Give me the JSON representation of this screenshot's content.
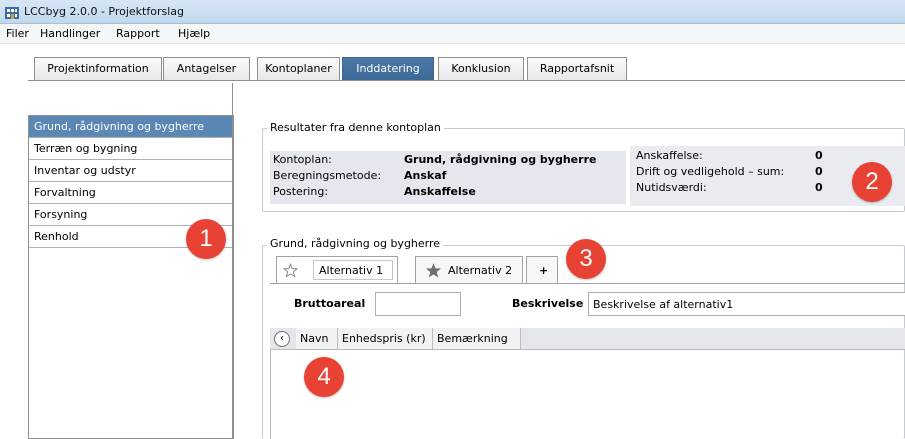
{
  "window": {
    "title": "LCCbyg 2.0.0 - Projektforslag",
    "icon": "app-building-icon"
  },
  "menu": [
    "Filer",
    "Handlinger",
    "Rapport",
    "Hjælp"
  ],
  "tabs": [
    "Projektinformation",
    "Antagelser",
    "Kontoplaner",
    "Inddatering",
    "Konklusion",
    "Rapportafsnit"
  ],
  "active_tab": "Inddatering",
  "sidebar": {
    "items": [
      "Grund, rådgivning og bygherre",
      "Terræn og bygning",
      "Inventar og udstyr",
      "Forvaltning",
      "Forsyning",
      "Renhold"
    ],
    "active": "Grund, rådgivning og bygherre"
  },
  "results": {
    "title": "Resultater fra denne kontoplan",
    "rows": [
      {
        "label": "Kontoplan:",
        "value": "Grund, rådgivning og bygherre"
      },
      {
        "label": "Beregningsmetode:",
        "value": "Anskaf"
      },
      {
        "label": "Postering:",
        "value": "Anskaffelse"
      }
    ],
    "summary": [
      {
        "label": "Anskaffelse:",
        "value": "0"
      },
      {
        "label": "Drift og vedligehold – sum:",
        "value": "0"
      },
      {
        "label": "Nutidsværdi:",
        "value": "0"
      }
    ]
  },
  "section": {
    "title": "Grund, rådgivning og bygherre",
    "alternatives": [
      {
        "label": "Alternativ 1",
        "starred": false
      },
      {
        "label": "Alternativ 2",
        "starred": true
      }
    ],
    "add_label": "+",
    "fields": {
      "bruttoareal_label": "Bruttoareal",
      "bruttoareal_value": "",
      "beskrivelse_label": "Beskrivelse",
      "beskrivelse_value": "Beskrivelse af alternativ1"
    },
    "grid": {
      "columns": [
        "Navn",
        "Enhedspris (kr)",
        "Bemærkning"
      ]
    }
  },
  "callouts": [
    "1",
    "2",
    "3",
    "4"
  ],
  "colors": {
    "accent": "#4a76a3",
    "badge": "#e84235"
  }
}
